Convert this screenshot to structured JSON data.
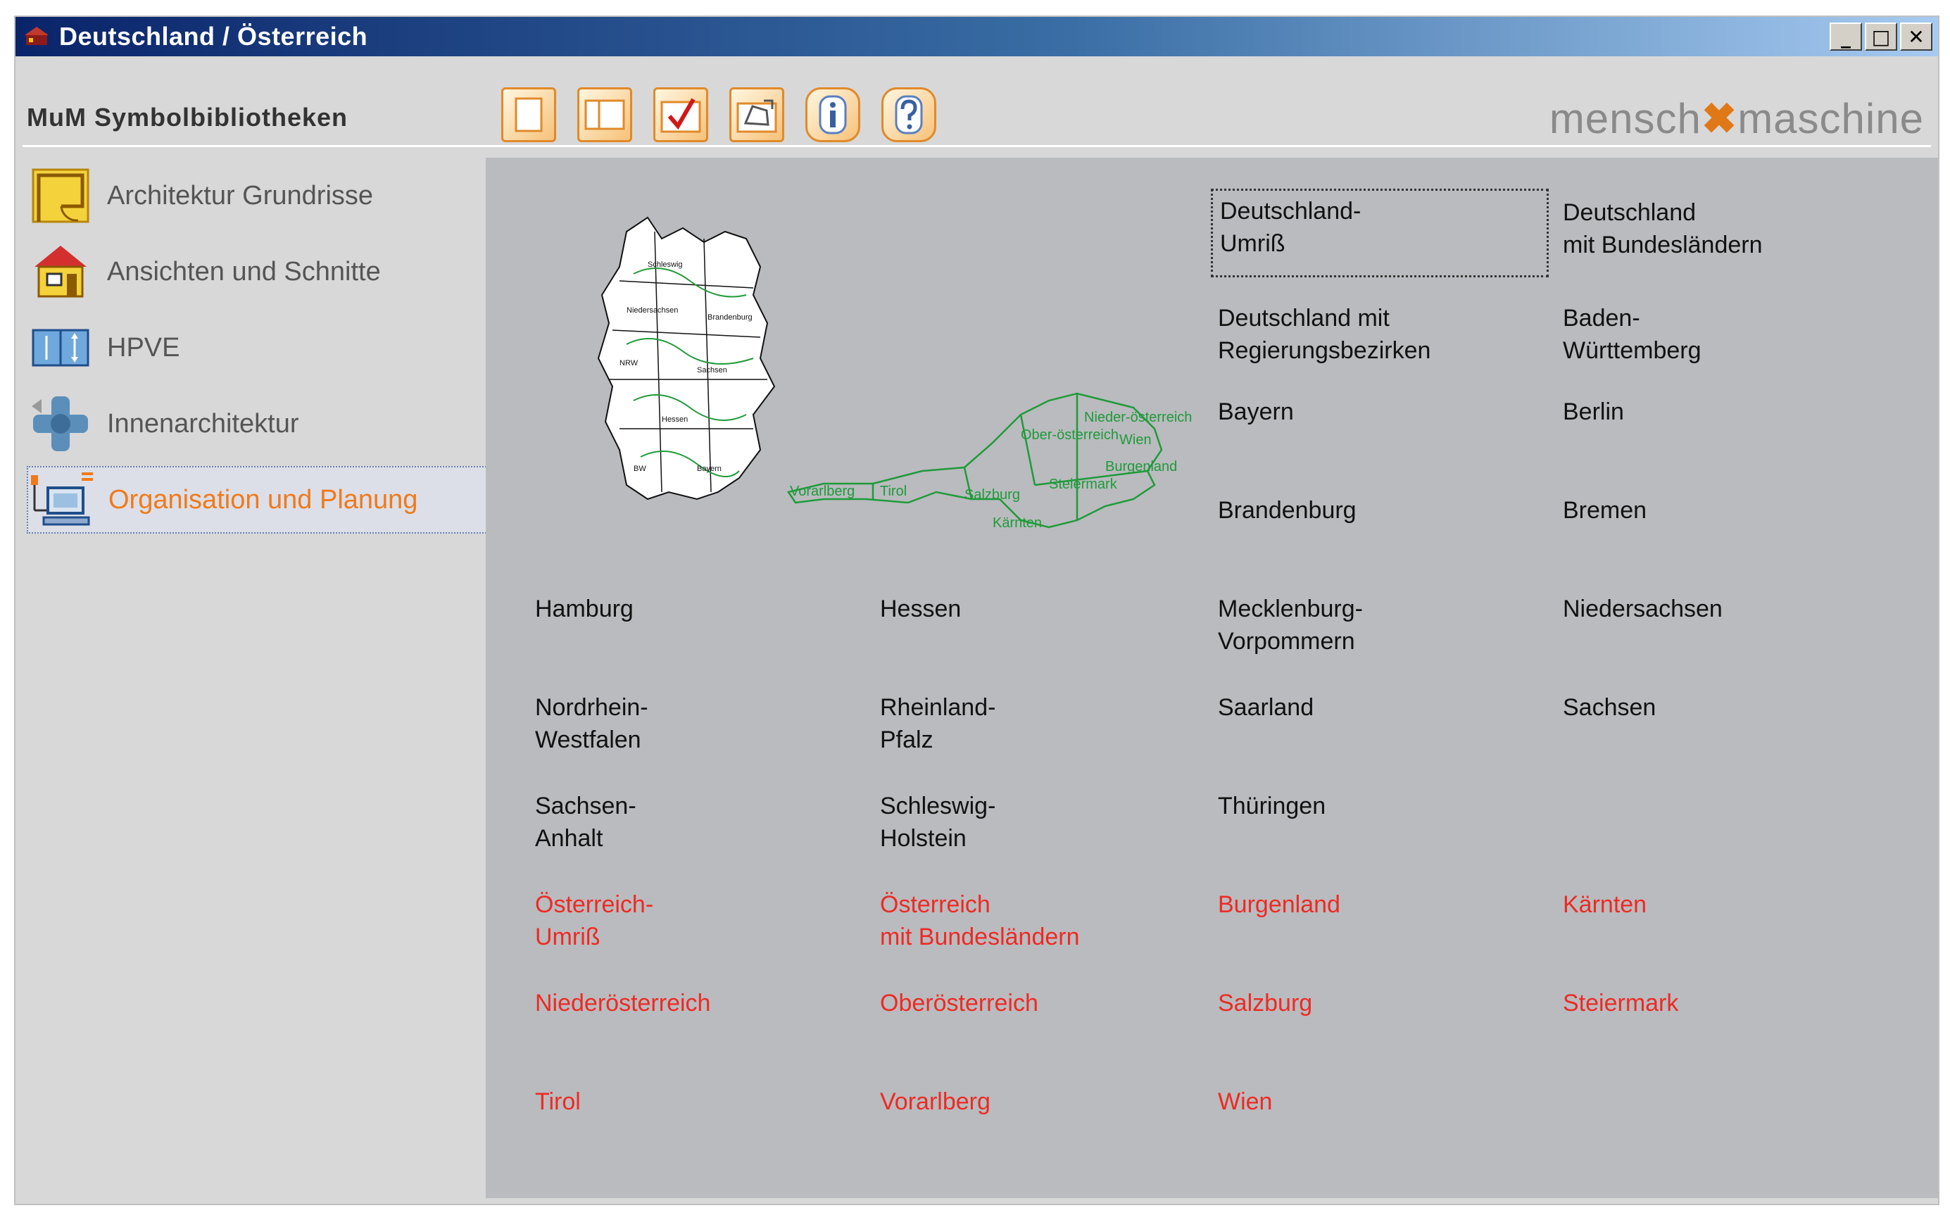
{
  "window": {
    "title": "Deutschland / Österreich",
    "controls": {
      "minimize": "_",
      "maximize": "□",
      "close": "✕"
    }
  },
  "header": {
    "library_title": "MuM Symbolbibliotheken",
    "brand_left": "mensch",
    "brand_mark": "✖",
    "brand_right": "maschine"
  },
  "toolbar": [
    {
      "name": "new-drawing-icon"
    },
    {
      "name": "open-drawing-icon"
    },
    {
      "name": "checkmark-icon"
    },
    {
      "name": "insert-symbol-icon"
    },
    {
      "name": "info-icon"
    },
    {
      "name": "help-icon"
    }
  ],
  "sidebar": {
    "items": [
      {
        "label": "Architektur Grundrisse",
        "icon": "floorplan-icon"
      },
      {
        "label": "Ansichten und Schnitte",
        "icon": "house-icon"
      },
      {
        "label": "HPVE",
        "icon": "hpve-icon"
      },
      {
        "label": "Innenarchitektur",
        "icon": "interior-icon"
      },
      {
        "label": "Organisation und Planung",
        "icon": "computer-icon",
        "active": true
      }
    ]
  },
  "colors": {
    "accent": "#f07a1a",
    "red_text": "#ee2a24",
    "panel_bg": "#b9bbbe",
    "map_green": "#1f9a3a"
  },
  "maps": {
    "austria_labels": [
      "Vorarlberg",
      "Tirol",
      "Salzburg",
      "Kärnten",
      "Steiermark",
      "Ober-österreich",
      "Nieder-österreich",
      "Wien",
      "Burgenland"
    ]
  },
  "symbols": {
    "de_umriss": "Deutschland-\nUmriß",
    "de_bundeslaender": "Deutschland\nmit Bundesländern",
    "de_regbez": "Deutschland mit\nRegierungsbezirken",
    "baden_wuerttemberg": "Baden-\nWürttemberg",
    "bayern": "Bayern",
    "berlin": "Berlin",
    "brandenburg": "Brandenburg",
    "bremen": "Bremen",
    "hamburg": "Hamburg",
    "hessen": "Hessen",
    "mecklenburg": "Mecklenburg-\nVorpommern",
    "niedersachsen": "Niedersachsen",
    "nrw": "Nordrhein-\nWestfalen",
    "rheinland_pfalz": "Rheinland-\nPfalz",
    "saarland": "Saarland",
    "sachsen": "Sachsen",
    "sachsen_anhalt": "Sachsen-\nAnhalt",
    "schleswig_holstein": "Schleswig-\nHolstein",
    "thueringen": "Thüringen",
    "at_umriss": "Österreich-\nUmriß",
    "at_bundeslaender": "Österreich\nmit Bundesländern",
    "burgenland": "Burgenland",
    "kaernten": "Kärnten",
    "niederoesterreich": "Niederösterreich",
    "oberoesterreich": "Oberösterreich",
    "salzburg": "Salzburg",
    "steiermark": "Steiermark",
    "tirol": "Tirol",
    "vorarlberg": "Vorarlberg",
    "wien": "Wien"
  }
}
